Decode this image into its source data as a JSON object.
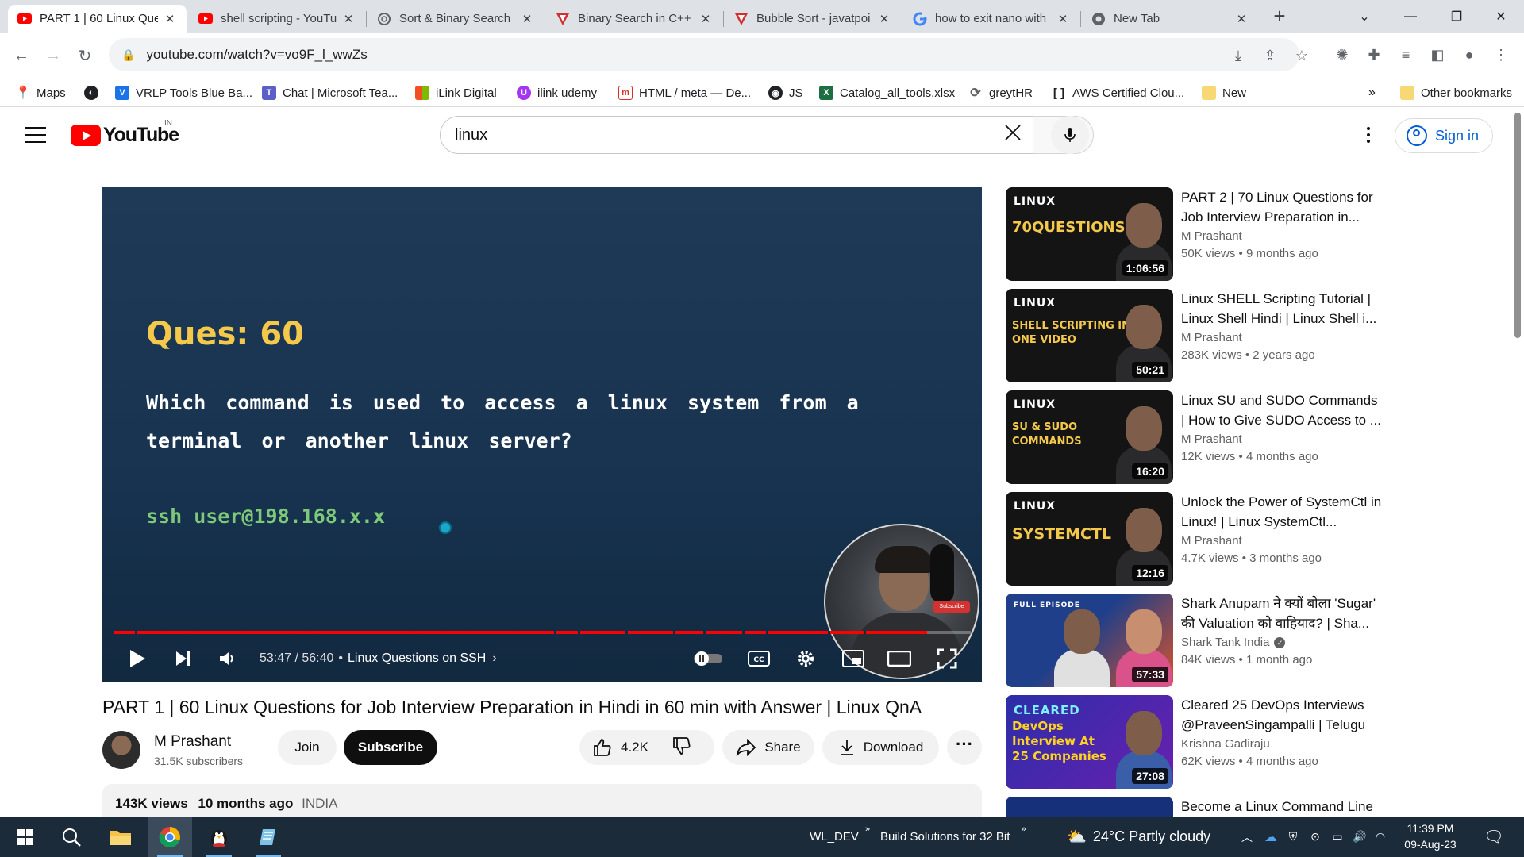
{
  "browser": {
    "tabs": [
      {
        "title": "PART 1 | 60 Linux Que",
        "icon": "youtube-icon",
        "active": true
      },
      {
        "title": "shell scripting - YouTu",
        "icon": "youtube-icon",
        "active": false
      },
      {
        "title": "Sort & Binary Search",
        "icon": "openai-icon",
        "active": false
      },
      {
        "title": "Binary Search in C++",
        "icon": "tpoint-icon",
        "active": false
      },
      {
        "title": "Bubble Sort - javatpoi",
        "icon": "tpoint-icon",
        "active": false
      },
      {
        "title": "how to exit nano with",
        "icon": "google-icon",
        "active": false
      },
      {
        "title": "New Tab",
        "icon": "chrome-icon",
        "active": false
      }
    ],
    "new_tab": "+",
    "url": "youtube.com/watch?v=vo9F_l_wwZs",
    "bookmarks": [
      {
        "label": "Maps",
        "icon": "maps-icon",
        "color": "#ea4335"
      },
      {
        "label": "",
        "icon": "globe-icon",
        "color": "#202124"
      },
      {
        "label": "VRLP Tools Blue Ba...",
        "icon": "vrlp-icon",
        "color": "#1a73e8"
      },
      {
        "label": "Chat | Microsoft Tea...",
        "icon": "teams-icon",
        "color": "#5b5fc7"
      },
      {
        "label": "iLink Digital",
        "icon": "windows-tiles-icon",
        "color": "#f25022"
      },
      {
        "label": "ilink udemy",
        "icon": "udemy-icon",
        "color": "#a435f0"
      },
      {
        "label": "HTML / meta — De...",
        "icon": "mdn-icon",
        "color": "#d93025"
      },
      {
        "label": "JS",
        "icon": "github-icon",
        "color": "#202124"
      },
      {
        "label": "Catalog_all_tools.xlsx",
        "icon": "excel-icon",
        "color": "#1d6f42"
      },
      {
        "label": "greytHR",
        "icon": "greythr-icon",
        "color": "#5f6368"
      },
      {
        "label": "AWS Certified Clou...",
        "icon": "bracket-icon",
        "color": "#202124"
      },
      {
        "label": "New",
        "icon": "folder-icon",
        "color": "#f8d775"
      }
    ],
    "other_bookmarks": "Other bookmarks"
  },
  "youtube": {
    "country": "IN",
    "search_query": "linux",
    "sign_in": "Sign in"
  },
  "player": {
    "question_title": "Ques: 60",
    "question_text": "Which command is used to access a linux system from a terminal or another linux server?",
    "answer": "ssh user@198.168.x.x",
    "current_time": "53:47",
    "total_time": "56:40",
    "time_display": "53:47 / 56:40",
    "chapter": "Linux Questions on SSH",
    "progress_fraction": 0.949,
    "cam_badge": "Subscribe"
  },
  "video": {
    "title": "PART 1 | 60 Linux Questions for Job Interview Preparation in Hindi in 60 min with Answer | Linux QnA",
    "channel": "M Prashant",
    "subscribers": "31.5K subscribers",
    "join": "Join",
    "subscribe": "Subscribe",
    "likes": "4.2K",
    "share": "Share",
    "download": "Download",
    "views": "143K views",
    "age": "10 months ago",
    "location": "INDIA"
  },
  "sidebar": [
    {
      "title": "PART 2 | 70 Linux Questions for Job Interview Preparation in...",
      "channel": "M Prashant",
      "verified": false,
      "meta": "50K views  • 9 months ago",
      "duration": "1:06:56",
      "thumb_top": "LINUX",
      "thumb_main": "70QUESTIONS",
      "bg": "#141414",
      "accent": "#f4c84b"
    },
    {
      "title": "Linux SHELL Scripting Tutorial | Linux Shell Hindi | Linux Shell i...",
      "channel": "M Prashant",
      "verified": false,
      "meta": "283K views  • 2 years ago",
      "duration": "50:21",
      "thumb_top": "LINUX",
      "thumb_main": "SHELL SCRIPTING IN ONE VIDEO",
      "bg": "#141414",
      "accent": "#f4c84b"
    },
    {
      "title": "Linux SU and SUDO Commands | How to Give SUDO Access to ...",
      "channel": "M Prashant",
      "verified": false,
      "meta": "12K views  • 4 months ago",
      "duration": "16:20",
      "thumb_top": "LINUX",
      "thumb_main": "SU & SUDO COMMANDS",
      "bg": "#141414",
      "accent": "#f4c84b"
    },
    {
      "title": "Unlock the Power of SystemCtl in Linux! | Linux SystemCtl...",
      "channel": "M Prashant",
      "verified": false,
      "meta": "4.7K views  • 3 months ago",
      "duration": "12:16",
      "thumb_top": "LINUX",
      "thumb_main": "SYSTEMCTL",
      "bg": "#141414",
      "accent": "#f4c84b"
    },
    {
      "title": "Shark Anupam ने क्यों बोला 'Sugar' की Valuation को वाहियाद? | Sha...",
      "channel": "Shark Tank India",
      "verified": true,
      "meta": "84K views  • 1 month ago",
      "duration": "57:33",
      "thumb_top": "FULL EPISODE",
      "thumb_main": "",
      "bg": "#1f3f8a",
      "accent": "#e25b1f"
    },
    {
      "title": "Cleared 25 DevOps Interviews @PraveenSingampalli | Telugu",
      "channel": "Krishna Gadiraju",
      "verified": false,
      "meta": "62K views  • 4 months ago",
      "duration": "27:08",
      "thumb_top": "CLEARED",
      "thumb_main": "DevOps Interview At 25 Companies",
      "bg": "#2b2ea8",
      "accent": "#ffd21f"
    },
    {
      "title": "Become a Linux Command Line",
      "channel": "",
      "verified": false,
      "meta": "",
      "duration": "",
      "thumb_top": "",
      "thumb_main": "",
      "bg": "#16307a",
      "accent": "#ffffff"
    }
  ],
  "taskbar": {
    "items": [
      {
        "label": "WL_DEV"
      },
      {
        "label": "Build Solutions for 32 Bit"
      }
    ],
    "weather": "24°C  Partly cloudy",
    "time": "11:39 PM",
    "date": "09-Aug-23"
  }
}
